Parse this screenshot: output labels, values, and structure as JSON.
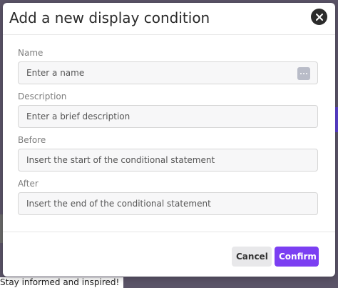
{
  "modal": {
    "title": "Add a new display condition",
    "close_icon": "close-icon"
  },
  "fields": {
    "name": {
      "label": "Name",
      "placeholder": "Enter a name",
      "value": ""
    },
    "description": {
      "label": "Description",
      "placeholder": "Enter a brief description",
      "value": ""
    },
    "before": {
      "label": "Before",
      "placeholder": "Insert the start of the conditional statement",
      "value": ""
    },
    "after": {
      "label": "After",
      "placeholder": "Insert the end of the conditional statement",
      "value": ""
    }
  },
  "footer": {
    "cancel_label": "Cancel",
    "confirm_label": "Confirm"
  },
  "background": {
    "bottom_text": "Stay informed and inspired!"
  },
  "colors": {
    "accent": "#7b3ff2",
    "overlay": "#5b5468"
  }
}
